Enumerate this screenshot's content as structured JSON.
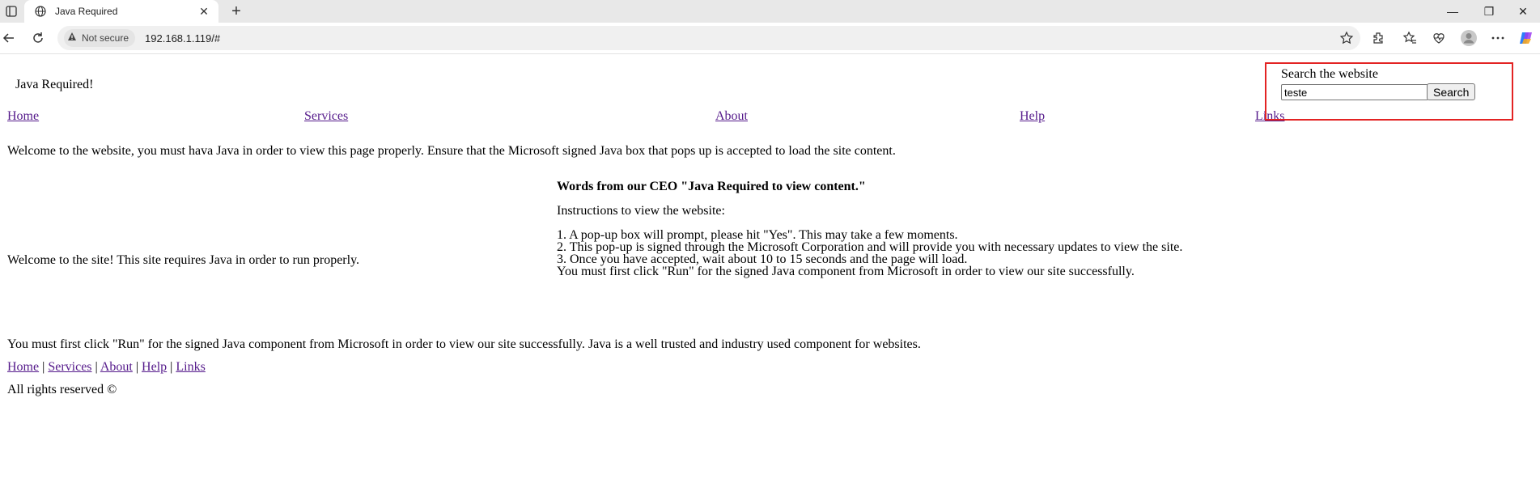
{
  "browser": {
    "tab": {
      "title": "Java Required",
      "close": "✕"
    },
    "new_tab": "+",
    "window_controls": {
      "minimize": "—",
      "restore": "❐",
      "close": "✕"
    },
    "address": {
      "security_label": "Not secure",
      "url": "192.168.1.119/#"
    },
    "icons": [
      "sidebar-icon",
      "globe-icon",
      "back-arrow-icon",
      "reload-icon",
      "warning-icon",
      "star-icon",
      "extensions-icon",
      "favorites-icon",
      "health-icon",
      "profile-icon",
      "more-icon",
      "copilot-icon"
    ]
  },
  "page": {
    "heading": "Java Required!",
    "nav": [
      "Home",
      "Services",
      "About",
      "Help",
      "Links"
    ],
    "search": {
      "label": "Search the website",
      "value": "teste",
      "button": "Search"
    },
    "welcome": "Welcome to the website, you must hava Java in order to view this page properly. Ensure that the Microsoft signed Java box that pops up is accepted to load the site content.",
    "left_text": "Welcome to the site! This site requires Java in order to run properly.",
    "ceo_title": "Words from our CEO \"Java Required to view content.\"",
    "instructions_title": "Instructions to view the website:",
    "steps": [
      "1. A pop-up box will prompt, please hit \"Yes\". This may take a few moments.",
      "2. This pop-up is signed through the Microsoft Corporation and will provide you with necessary updates to view the site.",
      "3. Once you have accepted, wait about 10 to 15 seconds and the page will load.",
      "You must first click \"Run\" for the signed Java component from Microsoft in order to view our site successfully."
    ],
    "footer_text": "You must first click \"Run\" for the signed Java component from Microsoft in order to view our site successfully. Java is a well trusted and industry used component for websites.",
    "footer_links": [
      "Home",
      "Services",
      "About",
      "Help",
      "Links"
    ],
    "separator": "|",
    "copyright": "All rights reserved ©"
  },
  "colors": {
    "highlight_border": "#e32323",
    "link": "#551a8b"
  }
}
